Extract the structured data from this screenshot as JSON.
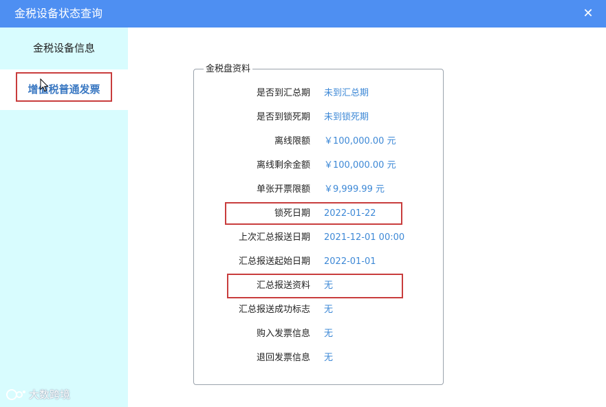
{
  "window": {
    "title": "金税设备状态查询",
    "close_glyph": "✕"
  },
  "sidebar": {
    "items": [
      {
        "label": "金税设备信息"
      },
      {
        "label": "增值税普通发票"
      }
    ]
  },
  "panel": {
    "legend": "金税盘资料",
    "rows": [
      {
        "label": "是否到汇总期",
        "value": "未到汇总期"
      },
      {
        "label": "是否到锁死期",
        "value": "未到锁死期"
      },
      {
        "label": "离线限额",
        "value": "￥100,000.00 元"
      },
      {
        "label": "离线剩余金额",
        "value": "￥100,000.00 元"
      },
      {
        "label": "单张开票限额",
        "value": "￥9,999.99 元"
      },
      {
        "label": "锁死日期",
        "value": "2022-01-22"
      },
      {
        "label": "上次汇总报送日期",
        "value": "2021-12-01 00:00"
      },
      {
        "label": "汇总报送起始日期",
        "value": "2022-01-01"
      },
      {
        "label": "汇总报送资料",
        "value": "无"
      },
      {
        "label": "汇总报送成功标志",
        "value": "无"
      },
      {
        "label": "购入发票信息",
        "value": "无"
      },
      {
        "label": "退回发票信息",
        "value": "无"
      }
    ]
  },
  "watermark": {
    "text": "大数跨境"
  },
  "colors": {
    "titlebar": "#4e8ff2",
    "sidebar": "#d8fcfe",
    "value_text": "#3d88d6",
    "highlight_box": "#c83c3c"
  },
  "icons": [
    "close-icon",
    "mouse-cursor-icon",
    "watermark-logo-icon"
  ]
}
